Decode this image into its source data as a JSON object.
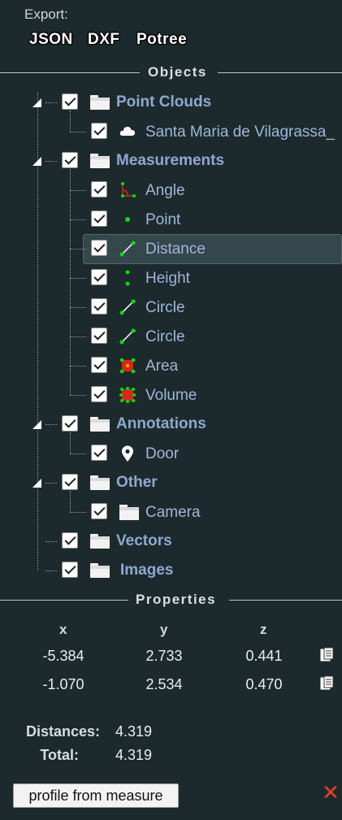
{
  "export": {
    "label": "Export:",
    "buttons": [
      "JSON",
      "DXF",
      "Potree"
    ]
  },
  "objects_header": "Objects",
  "tree": {
    "point_clouds": {
      "label": "Point Clouds",
      "items": [
        {
          "label": "Santa Maria de Vilagrassa_",
          "icon": "cloud-icon"
        }
      ]
    },
    "measurements": {
      "label": "Measurements",
      "items": [
        {
          "label": "Angle",
          "icon": "angle-icon"
        },
        {
          "label": "Point",
          "icon": "point-icon"
        },
        {
          "label": "Distance",
          "icon": "distance-icon",
          "selected": true
        },
        {
          "label": "Height",
          "icon": "height-icon"
        },
        {
          "label": "Circle",
          "icon": "circle-icon"
        },
        {
          "label": "Circle",
          "icon": "circle-icon"
        },
        {
          "label": "Area",
          "icon": "area-icon"
        },
        {
          "label": "Volume",
          "icon": "volume-icon"
        }
      ]
    },
    "annotations": {
      "label": "Annotations",
      "items": [
        {
          "label": "Door",
          "icon": "map-pin-icon"
        }
      ]
    },
    "other": {
      "label": "Other",
      "items": [
        {
          "label": "Camera",
          "icon": "folder-icon"
        }
      ]
    },
    "vectors": {
      "label": "Vectors"
    },
    "images": {
      "label": "Images"
    }
  },
  "properties_header": "Properties",
  "properties": {
    "columns": [
      "x",
      "y",
      "z"
    ],
    "rows": [
      [
        "-5.384",
        "2.733",
        "0.441"
      ],
      [
        "-1.070",
        "2.534",
        "0.470"
      ]
    ]
  },
  "summary": {
    "distances_label": "Distances:",
    "distances_value": "4.319",
    "total_label": "Total:",
    "total_value": "4.319"
  },
  "profile_button": "profile from measure",
  "close_symbol": "✕",
  "colors": {
    "background": "#1d2a2d",
    "folder_label": "#8fa8cf",
    "item_label": "#9fb6d8",
    "close": "#e8431c",
    "measure_green": "#00e000",
    "area_red": "#d9261c"
  }
}
